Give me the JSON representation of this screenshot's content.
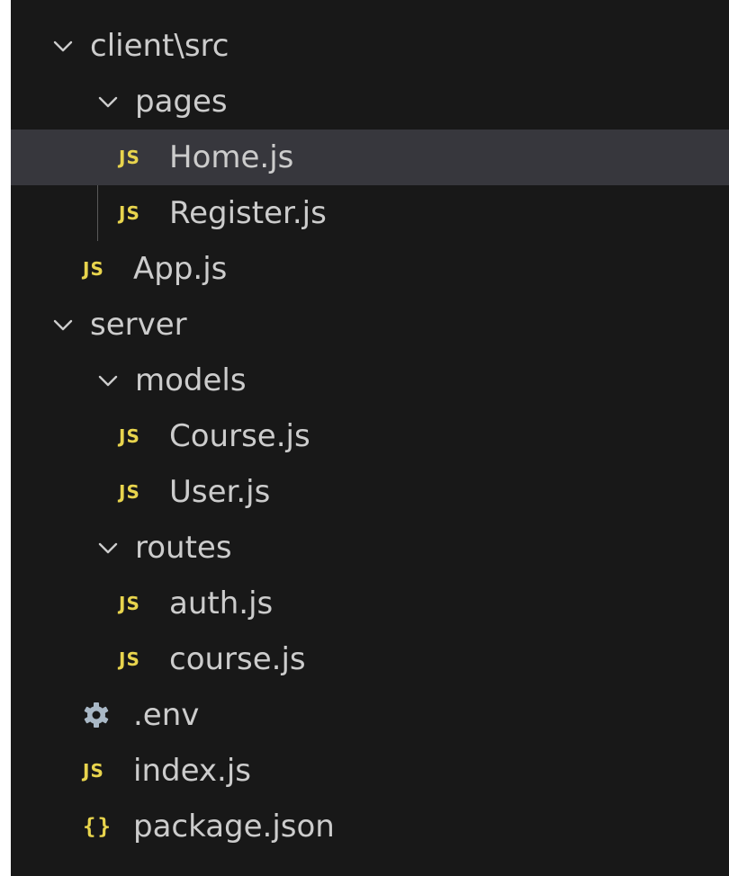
{
  "explorer": {
    "items": [
      {
        "label": "client\\src",
        "kind": "folder",
        "expanded": true,
        "icon": "chevron-down-icon"
      },
      {
        "label": "pages",
        "kind": "folder",
        "expanded": true,
        "icon": "chevron-down-icon"
      },
      {
        "label": "Home.js",
        "kind": "file",
        "icon": "javascript-file-icon",
        "icon_text": "JS",
        "selected": true
      },
      {
        "label": "Register.js",
        "kind": "file",
        "icon": "javascript-file-icon",
        "icon_text": "JS"
      },
      {
        "label": "App.js",
        "kind": "file",
        "icon": "javascript-file-icon",
        "icon_text": "JS"
      },
      {
        "label": "server",
        "kind": "folder",
        "expanded": true,
        "icon": "chevron-down-icon"
      },
      {
        "label": "models",
        "kind": "folder",
        "expanded": true,
        "icon": "chevron-down-icon"
      },
      {
        "label": "Course.js",
        "kind": "file",
        "icon": "javascript-file-icon",
        "icon_text": "JS"
      },
      {
        "label": "User.js",
        "kind": "file",
        "icon": "javascript-file-icon",
        "icon_text": "JS"
      },
      {
        "label": "routes",
        "kind": "folder",
        "expanded": true,
        "icon": "chevron-down-icon"
      },
      {
        "label": "auth.js",
        "kind": "file",
        "icon": "javascript-file-icon",
        "icon_text": "JS"
      },
      {
        "label": "course.js",
        "kind": "file",
        "icon": "javascript-file-icon",
        "icon_text": "JS"
      },
      {
        "label": ".env",
        "kind": "file",
        "icon": "gear-icon"
      },
      {
        "label": "index.js",
        "kind": "file",
        "icon": "javascript-file-icon",
        "icon_text": "JS"
      },
      {
        "label": "package.json",
        "kind": "file",
        "icon": "json-braces-icon",
        "icon_text": "{}"
      }
    ]
  },
  "colors": {
    "background": "#181818",
    "selected_row": "#37373d",
    "text": "#cccccc",
    "js_icon": "#e8d44d",
    "gear_icon": "#a9b8c6"
  }
}
